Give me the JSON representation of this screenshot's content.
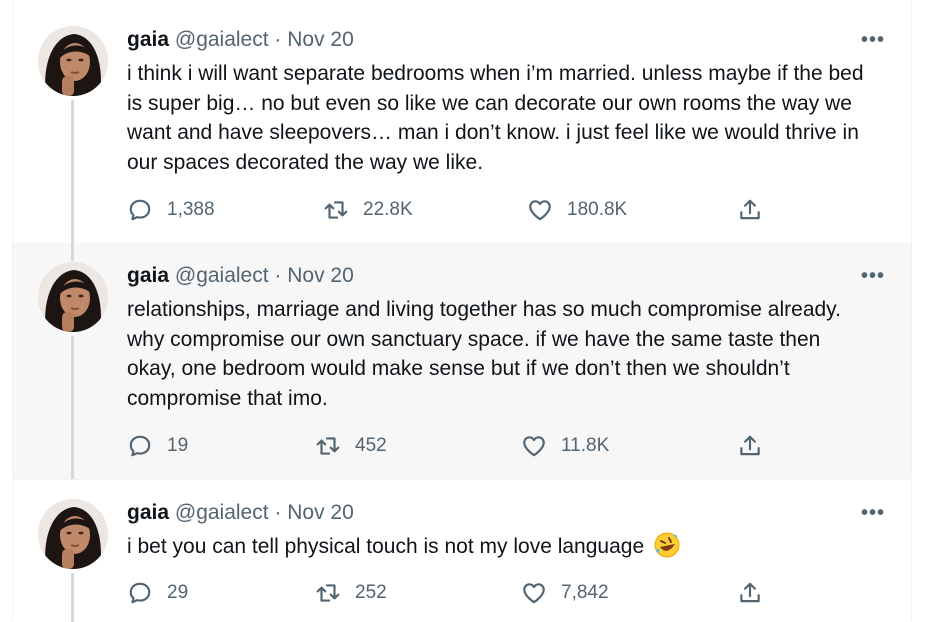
{
  "tweets": [
    {
      "name": "gaia",
      "handle": "@gaialect",
      "date": "· Nov 20",
      "text": "i think i will want separate bedrooms when i’m married. unless maybe if the bed is super big… no but even so like we can decorate our own rooms the way we want and have sleepovers… man i don’t know. i just feel like we would thrive in our spaces decorated the way we like.",
      "replies": "1,388",
      "retweets": "22.8K",
      "likes": "180.8K"
    },
    {
      "name": "gaia",
      "handle": "@gaialect",
      "date": "· Nov 20",
      "text": "relationships, marriage and living together has so much compromise already. why compromise our own sanctuary space. if we have the same taste then okay, one bedroom would make sense but if we don’t then we shouldn’t compromise that imo.",
      "replies": "19",
      "retweets": "452",
      "likes": "11.8K"
    },
    {
      "name": "gaia",
      "handle": "@gaialect",
      "date": "· Nov 20",
      "text": "i bet you can tell physical touch is not my love language",
      "emoji": "rolling-on-floor-laughing-emoji",
      "replies": "29",
      "retweets": "252",
      "likes": "7,842"
    }
  ],
  "more_label": "•••",
  "colors": {
    "muted": "#536471",
    "highlight_bg": "#f7f7f7",
    "thread_line": "#cfd9de"
  }
}
